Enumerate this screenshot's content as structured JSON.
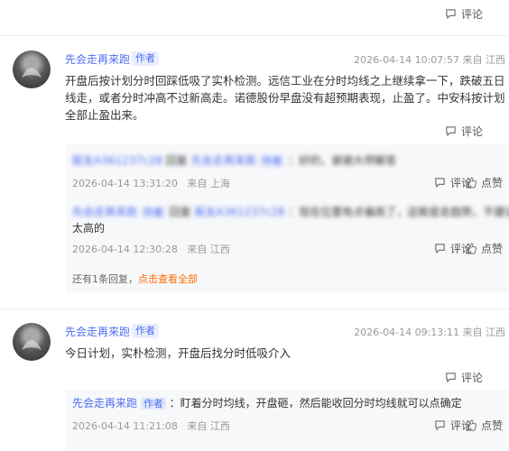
{
  "top": {
    "comment_label": "评论"
  },
  "comments": [
    {
      "author": "先会走再来跑",
      "tag": "作者",
      "date": "2026-04-14 10:07:57",
      "location": "来自 江西",
      "text": "开盘后按计划分时回踩低吸了实朴检测。远信工业在分时均线之上继续拿一下，跌破五日线走，或者分时冲高不过新高走。诺德股份早盘没有超预期表现，止盈了。中安科按计划全部止盈出来。",
      "comment_label": "评论",
      "replies": [
        {
          "user": "股友A361237c28",
          "reply_word": "回复",
          "to": "先会走再来跑",
          "to_tag": "作者",
          "text": "：好的，谢谢大师解答",
          "date": "2026-04-14 13:31:20",
          "location": "来自 上海",
          "comment_label": "评论",
          "like_label": "点赞"
        },
        {
          "user": "先会走再来跑",
          "user_tag": "作者",
          "reply_word": "回复",
          "to": "股友A361237c28",
          "text": "：现在位置有点偏高了，这股是走趋势，不建议追",
          "text_wrap": "太高的",
          "date": "2026-04-14 12:30:28",
          "location": "来自 江西",
          "comment_label": "评论",
          "like_label": "点赞"
        }
      ],
      "more": {
        "count_text": "还有1条回复，",
        "link_text": "点击查看全部"
      }
    },
    {
      "author": "先会走再来跑",
      "tag": "作者",
      "date": "2026-04-14 09:13:11",
      "location": "来自 江西",
      "text": "今日计划，实朴检测，开盘后找分时低吸介入",
      "comment_label": "评论",
      "replies": [
        {
          "user": "先会走再来跑",
          "user_tag": "作者",
          "text": "：盯着分时均线，开盘砸，然后能收回分时均线就可以点确定",
          "date": "2026-04-14 11:21:08",
          "location": "来自 江西",
          "comment_label": "评论",
          "like_label": "点赞"
        }
      ]
    }
  ]
}
